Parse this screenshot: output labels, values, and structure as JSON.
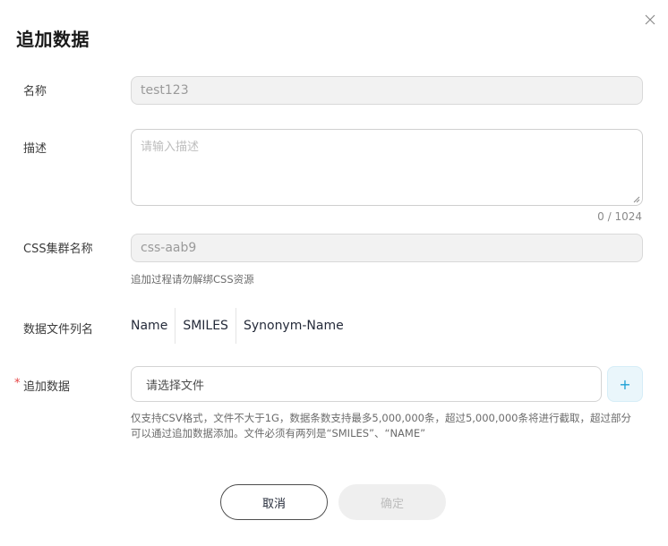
{
  "dialog": {
    "title": "追加数据"
  },
  "fields": {
    "name": {
      "label": "名称",
      "value": "test123"
    },
    "description": {
      "label": "描述",
      "placeholder": "请输入描述",
      "counter": "0 / 1024"
    },
    "css_cluster": {
      "label": "CSS集群名称",
      "value": "css-aab9",
      "hint": "追加过程请勿解绑CSS资源"
    },
    "data_columns": {
      "label": "数据文件列名",
      "columns": [
        "Name",
        "SMILES",
        "Synonym-Name"
      ]
    },
    "append_data": {
      "required_mark": "*",
      "label": "追加数据",
      "file_placeholder": "请选择文件",
      "add_label": "+",
      "hint_line1": "仅支持CSV格式，文件不大于1G，数据条数支持最多5,000,000条，超过5,000,000条将进行截取，超过部分",
      "hint_line2": "可以通过追加数据添加。文件必须有两列是“SMILES”、“NAME”"
    }
  },
  "footer": {
    "cancel_label": "取消",
    "confirm_label": "确定"
  },
  "colors": {
    "accent": "#1ea1d6",
    "required": "#e54545",
    "disabled_bg": "#efefef"
  }
}
